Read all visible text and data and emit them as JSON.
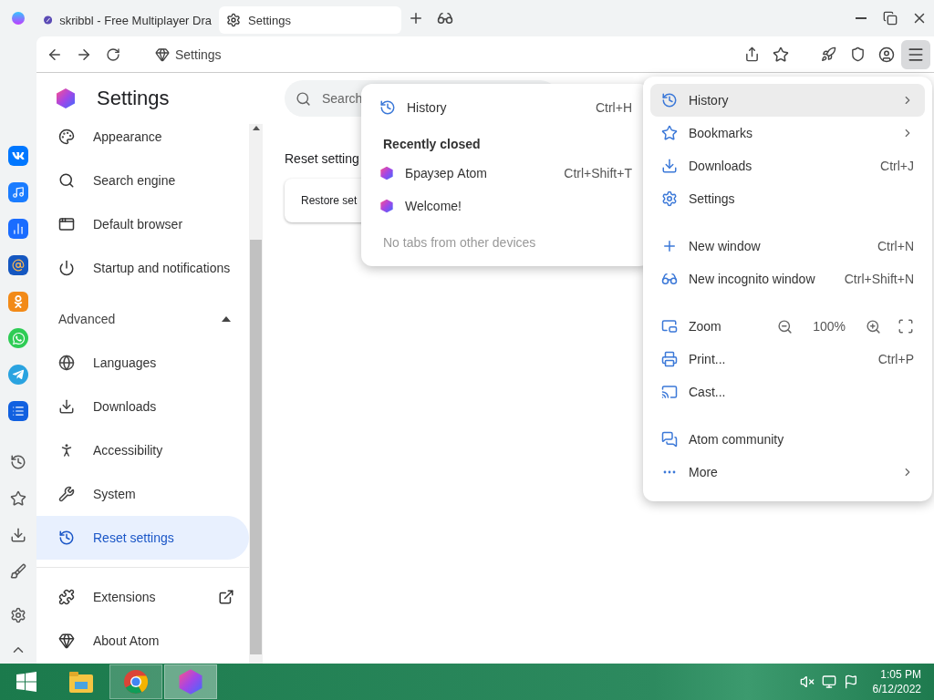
{
  "browser": {
    "tabs": [
      {
        "title": "skribbl - Free Multiplayer Dra",
        "selected": false
      },
      {
        "title": "Settings",
        "selected": true
      }
    ]
  },
  "toolbar": {
    "address": "Settings",
    "menu_open": true
  },
  "settings": {
    "title": "Settings",
    "search": {
      "placeholder": "Search"
    },
    "nav": [
      {
        "label": "Appearance",
        "selected": false
      },
      {
        "label": "Search engine",
        "selected": false
      },
      {
        "label": "Default browser",
        "selected": false
      },
      {
        "label": "Startup and notifications",
        "selected": false
      }
    ],
    "advanced": {
      "label": "Advanced",
      "expanded": true
    },
    "advanced_items": [
      {
        "label": "Languages",
        "selected": false
      },
      {
        "label": "Downloads",
        "selected": false
      },
      {
        "label": "Accessibility",
        "selected": false
      },
      {
        "label": "System",
        "selected": false
      },
      {
        "label": "Reset settings",
        "selected": true
      }
    ],
    "extra": [
      {
        "label": "Extensions",
        "external": true
      },
      {
        "label": "About Atom",
        "external": false
      }
    ],
    "section_title": "Reset setting",
    "card_row": "Restore set"
  },
  "history_menu": {
    "items": [
      {
        "label": "History",
        "shortcut": "Ctrl+H"
      }
    ],
    "heading": "Recently closed",
    "recent": [
      {
        "label": "Браузер Atom",
        "shortcut": "Ctrl+Shift+T"
      },
      {
        "label": "Welcome!"
      }
    ],
    "note": "No tabs from other devices"
  },
  "main_menu": {
    "groups": [
      [
        {
          "label": "History",
          "submenu": true,
          "selected": true
        },
        {
          "label": "Bookmarks",
          "submenu": true,
          "selected": false
        },
        {
          "label": "Downloads",
          "shortcut": "Ctrl+J",
          "selected": false
        },
        {
          "label": "Settings",
          "selected": false
        }
      ],
      [
        {
          "label": "New window",
          "shortcut": "Ctrl+N",
          "selected": false
        },
        {
          "label": "New incognito window",
          "shortcut": "Ctrl+Shift+N",
          "selected": false
        }
      ],
      [
        {
          "label": "Zoom",
          "kind": "zoom",
          "value": "100%",
          "selected": false
        },
        {
          "label": "Print...",
          "shortcut": "Ctrl+P",
          "selected": false
        },
        {
          "label": "Cast...",
          "selected": false
        }
      ],
      [
        {
          "label": "Atom community",
          "selected": false
        },
        {
          "label": "More",
          "submenu": true,
          "selected": false
        }
      ]
    ]
  },
  "taskbar": {
    "apps": [
      {
        "running": false,
        "selected": false
      },
      {
        "running": true,
        "selected": false
      },
      {
        "running": true,
        "selected": true
      }
    ],
    "time": "1:05 PM",
    "date": "6/12/2022"
  }
}
